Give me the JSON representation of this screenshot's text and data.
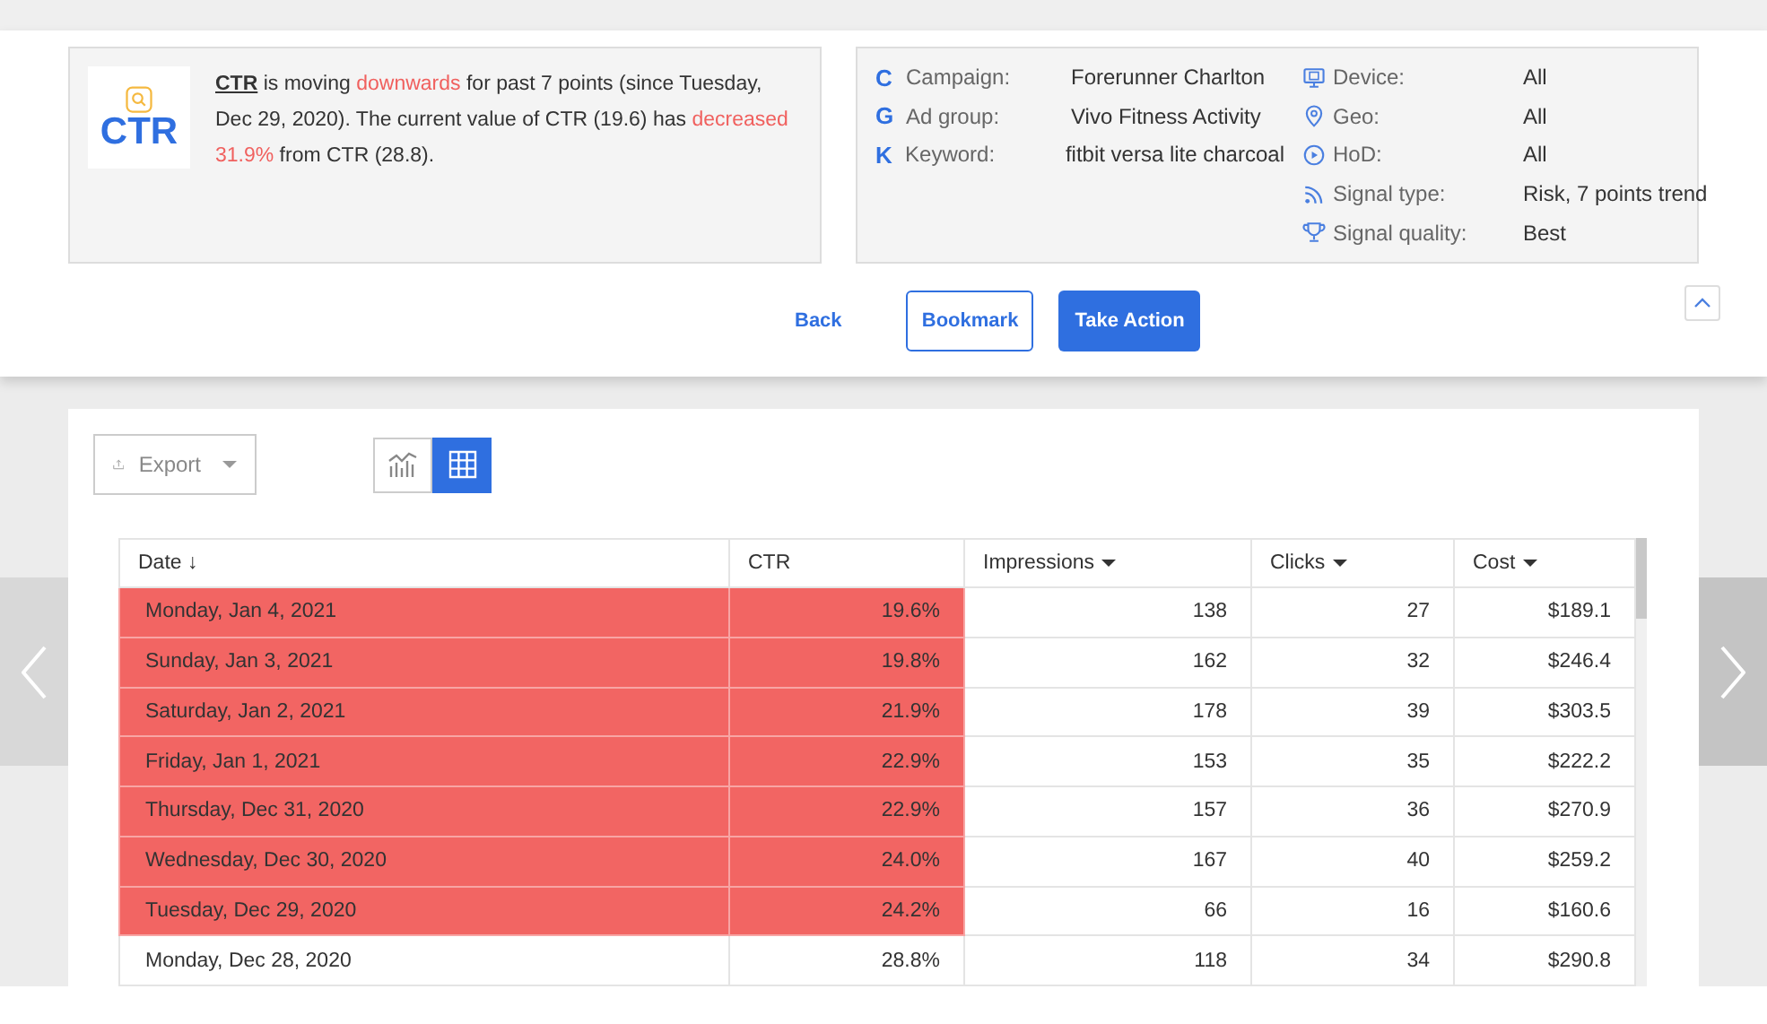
{
  "insight": {
    "badge": "CTR",
    "message": [
      {
        "kind": "metric",
        "text": "CTR"
      },
      {
        "kind": "plain",
        "text": " is moving "
      },
      {
        "kind": "negative",
        "text": "downwards"
      },
      {
        "kind": "plain",
        "text": " for past 7 points (since Tuesday, Dec 29, 2020). The current value of CTR (19.6) has "
      },
      {
        "kind": "negative",
        "text": "decreased 31.9%"
      },
      {
        "kind": "plain",
        "text": " from CTR (28.8)."
      }
    ]
  },
  "details_left": [
    {
      "icon": "C",
      "label": "Campaign:",
      "value": "Forerunner Charlton"
    },
    {
      "icon": "G",
      "label": "Ad group:",
      "value": "Vivo Fitness Activity"
    },
    {
      "icon": "K",
      "label": "Keyword:",
      "value": "fitbit versa lite charcoal"
    }
  ],
  "details_right": [
    {
      "kind": "device",
      "label": "Device:",
      "value": "All"
    },
    {
      "kind": "geo",
      "label": "Geo:",
      "value": "All"
    },
    {
      "kind": "hod",
      "label": "HoD:",
      "value": "All"
    },
    {
      "kind": "signal",
      "label": "Signal type:",
      "value": "Risk, 7 points trend"
    },
    {
      "kind": "quality",
      "label": "Signal quality:",
      "value": "Best"
    }
  ],
  "actions": [
    {
      "kind": "link",
      "label": "Back"
    },
    {
      "kind": "outline",
      "label": "Bookmark"
    },
    {
      "kind": "primary",
      "label": "Take Action"
    }
  ],
  "toolbar": {
    "export": "Export",
    "views": [
      {
        "kind": "chart",
        "selected": false
      },
      {
        "kind": "table",
        "selected": true
      }
    ]
  },
  "table": {
    "columns": [
      {
        "label": "Date ↓",
        "dropdown": false
      },
      {
        "label": "CTR",
        "dropdown": false
      },
      {
        "label": "Impressions",
        "dropdown": true
      },
      {
        "label": "Clicks",
        "dropdown": true
      },
      {
        "label": "Cost",
        "dropdown": true
      }
    ],
    "rows": [
      {
        "highlighted": true,
        "cells": [
          "Monday, Jan 4, 2021",
          "19.6%",
          "138",
          "27",
          "$189.1"
        ]
      },
      {
        "highlighted": true,
        "cells": [
          "Sunday, Jan 3, 2021",
          "19.8%",
          "162",
          "32",
          "$246.4"
        ]
      },
      {
        "highlighted": true,
        "cells": [
          "Saturday, Jan 2, 2021",
          "21.9%",
          "178",
          "39",
          "$303.5"
        ]
      },
      {
        "highlighted": true,
        "cells": [
          "Friday, Jan 1, 2021",
          "22.9%",
          "153",
          "35",
          "$222.2"
        ]
      },
      {
        "highlighted": true,
        "cells": [
          "Thursday, Dec 31, 2020",
          "22.9%",
          "157",
          "36",
          "$270.9"
        ]
      },
      {
        "highlighted": true,
        "cells": [
          "Wednesday, Dec 30, 2020",
          "24.0%",
          "167",
          "40",
          "$259.2"
        ]
      },
      {
        "highlighted": true,
        "cells": [
          "Tuesday, Dec 29, 2020",
          "24.2%",
          "66",
          "16",
          "$160.6"
        ]
      },
      {
        "highlighted": false,
        "cells": [
          "Monday, Dec 28, 2020",
          "28.8%",
          "118",
          "34",
          "$290.8"
        ]
      }
    ]
  }
}
